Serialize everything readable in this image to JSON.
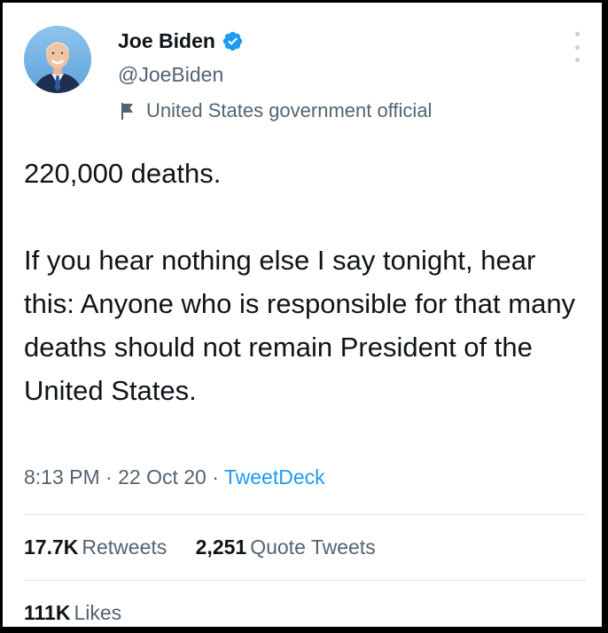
{
  "author": {
    "name": "Joe Biden",
    "handle": "@JoeBiden",
    "label": "United States government official"
  },
  "tweet": {
    "paragraph1": "220,000 deaths.",
    "paragraph2": "If you hear nothing else I say tonight, hear this: Anyone who is responsible for that many deaths should not remain President of the United States."
  },
  "meta": {
    "time": "8:13 PM",
    "separator": " · ",
    "date": "22 Oct 20",
    "source": "TweetDeck"
  },
  "stats": {
    "retweets_count": "17.7K",
    "retweets_label": "Retweets",
    "quotes_count": "2,251",
    "quotes_label": "Quote Tweets",
    "likes_count": "111K",
    "likes_label": "Likes"
  },
  "icons": {
    "verified": "verified-badge-icon",
    "label": "flag-icon",
    "menu": "more-icon"
  },
  "colors": {
    "accent": "#1d9bf0",
    "secondary_text": "#536471",
    "primary_text": "#0f1419"
  }
}
